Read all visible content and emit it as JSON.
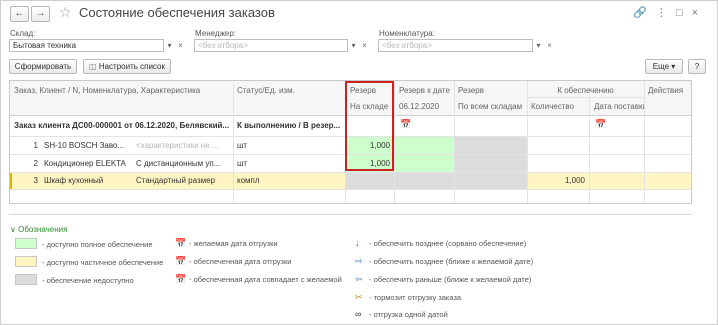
{
  "window": {
    "title": "Состояние обеспечения заказов"
  },
  "filters": {
    "warehouse": {
      "label": "Склад:",
      "value": "Бытовая техника"
    },
    "manager": {
      "label": "Менеджер:",
      "placeholder": "<без отбора>"
    },
    "nomenclature": {
      "label": "Номенклатура:",
      "placeholder": "<без отбора>"
    }
  },
  "toolbar": {
    "form_label": "Сформировать",
    "settings_label": "Настроить список",
    "more_label": "Еще",
    "help_label": "?"
  },
  "table": {
    "headers": {
      "col1": "Заказ, Клиент / N, Номенклатура, Характеристика",
      "col2": "Статус/Ед. изм.",
      "reserve": "Резерв",
      "reserve_sub": "На складе",
      "reserve_date": "Резерв к дате",
      "reserve_date_sub": "06.12.2020",
      "reserve_all": "Резерв",
      "reserve_all_sub": "По всем складам",
      "supply": "К обеспечению",
      "qty_sub": "Количество",
      "date_sub": "Дата поставки",
      "actions": "Действия"
    },
    "order": {
      "text": "Заказ клиента ДС00-000001 от 06.12.2020, Белявский...",
      "status": "К выполнению / В резер..."
    },
    "rows": [
      {
        "n": "1",
        "name": "SH-10 BOSCH Заво...",
        "char": "<характеристики не ...",
        "unit": "шт",
        "reserve": "1,000",
        "qty": "",
        "state": "green"
      },
      {
        "n": "2",
        "name": "Кондиционер ELEKTA",
        "char": "С дистанционным уп...",
        "unit": "шт",
        "reserve": "1,000",
        "qty": "",
        "state": "green"
      },
      {
        "n": "3",
        "name": "Шкаф кухонный",
        "char": "Стандартный размер",
        "unit": "компл",
        "reserve": "",
        "qty": "1,000",
        "state": "yellow"
      }
    ]
  },
  "legend": {
    "title": "Обозначения",
    "colors": [
      {
        "text": "- доступно полное обеспечение",
        "color": "#ccffcc"
      },
      {
        "text": "- доступно частичное обеспечение",
        "color": "#fff5c2"
      },
      {
        "text": "- обеспечение недоступно",
        "color": "#dcdcdc"
      }
    ],
    "icons_mid": [
      {
        "icon": "desired-date-icon",
        "text": "- желаемая дата отгрузки"
      },
      {
        "icon": "supplied-date-icon",
        "text": "- обеспеченная дата отгрузки"
      },
      {
        "icon": "date-match-icon",
        "text": "- обеспеченная дата совпадает с желаемой"
      }
    ],
    "icons_right": [
      {
        "icon": "later-broken-icon",
        "text": "- обеспечить позднее (сорвано обеспечение)"
      },
      {
        "icon": "later-icon",
        "text": "- обеспечить позднее (ближе к желаемой дате)"
      },
      {
        "icon": "earlier-icon",
        "text": "- обеспечить раньше (ближе к желаемой дате)"
      },
      {
        "icon": "blocks-shipment-icon",
        "text": "- тормозит отгрузку заказа"
      },
      {
        "icon": "one-date-icon",
        "text": "- отгрузка одной датой"
      }
    ]
  }
}
